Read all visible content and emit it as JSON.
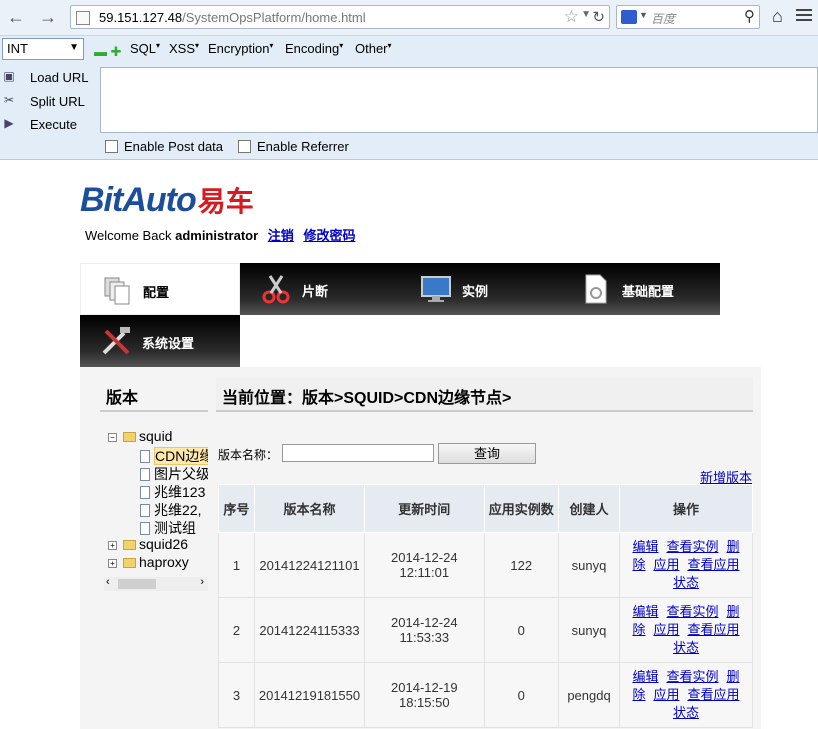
{
  "browser": {
    "url_host": "59.151.127.48",
    "url_path": "/SystemOpsPlatform/home.html",
    "search_placeholder": "百度"
  },
  "hackbar": {
    "select_value": "INT",
    "menus": [
      "SQL",
      "XSS",
      "Encryption",
      "Encoding",
      "Other"
    ],
    "load_url": "Load URL",
    "split_url": "Split URL",
    "execute": "Execute",
    "enable_post": "Enable Post data",
    "enable_referrer": "Enable Referrer"
  },
  "header": {
    "logo_text": "BitAuto",
    "logo_cn": "易车",
    "welcome": "Welcome Back",
    "user": "administrator",
    "logout": "注销",
    "change_password": "修改密码"
  },
  "nav": {
    "tabs": [
      "配置",
      "片断",
      "实例",
      "基础配置",
      "系统设置"
    ]
  },
  "sidebar": {
    "title": "版本",
    "tree": {
      "squid": "squid",
      "cdn": "CDN边缘节点",
      "img": "图片父级",
      "zw123": "兆维123",
      "zw22": "兆维22,",
      "test": "测试组",
      "squid26": "squid26",
      "haproxy": "haproxy"
    }
  },
  "main": {
    "breadcrumb": "当前位置：版本>SQUID>CDN边缘节点>",
    "version_name_label": "版本名称：",
    "query_button": "查询",
    "new_version": "新增版本",
    "columns": [
      "序号",
      "版本名称",
      "更新时间",
      "应用实例数",
      "创建人",
      "操作"
    ],
    "rows": [
      {
        "idx": "1",
        "name": "20141224121101",
        "date": "2014-12-24",
        "time": "12:11:01",
        "count": "122",
        "creator": "sunyq"
      },
      {
        "idx": "2",
        "name": "20141224115333",
        "date": "2014-12-24",
        "time": "11:53:33",
        "count": "0",
        "creator": "sunyq"
      },
      {
        "idx": "3",
        "name": "20141219181550",
        "date": "2014-12-19",
        "time": "18:15:50",
        "count": "0",
        "creator": "pengdq"
      }
    ],
    "ops": {
      "edit": "编辑",
      "view_instances": "查看实例",
      "delete_1": "删",
      "delete_2": "除",
      "apply": "应用",
      "view_apply_1": "查看应用",
      "view_apply_2": "状态"
    }
  }
}
